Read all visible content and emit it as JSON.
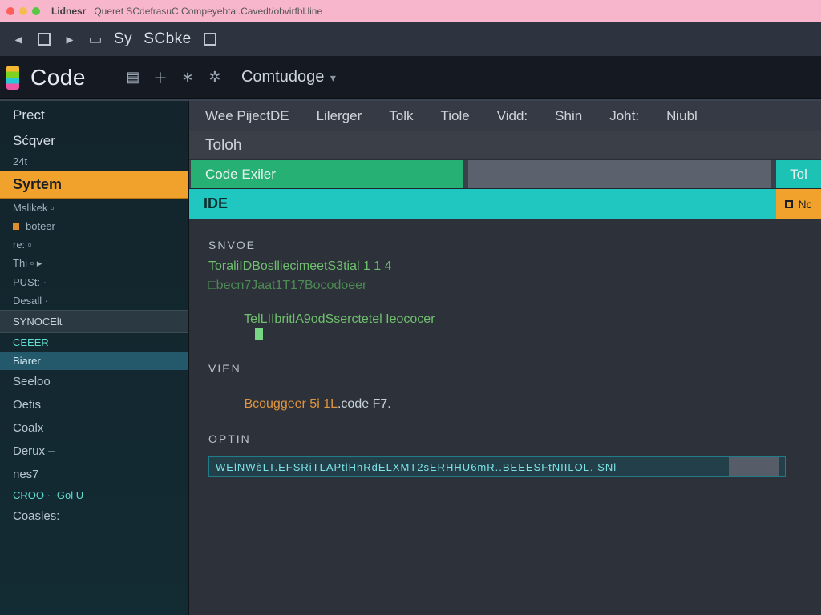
{
  "colors": {
    "accent_orange": "#f0a22c",
    "accent_green": "#26b074",
    "accent_cyan": "#20c7c1"
  },
  "titlebar": {
    "word1": "Lidnesr",
    "word2": "Queret SCdefrasuC Compeyebtal.Cavedt/obvirfbl.line"
  },
  "toolbar": {
    "icons": [
      "arrow-left",
      "square",
      "arrow-right",
      "box"
    ],
    "label1": "Sy",
    "label2": "SCbke",
    "trail_icon": "square"
  },
  "brandrow": {
    "brand": "Code",
    "toolbar_icons": [
      "panel-icon",
      "plus-icon",
      "dot-icon",
      "gear-icon"
    ],
    "breadcrumb": "Comtudoge",
    "chevron": "▾"
  },
  "menus": [
    "Wee PijectDE",
    "Lilerger",
    "Tolk",
    "Tiole",
    "Vidd:",
    "Shin",
    "Joht:",
    "Niubl"
  ],
  "tabs": {
    "path": "Toloh",
    "green": "Code Exiler",
    "grey": "",
    "edge": "Tol",
    "ide_label": "IDE",
    "ide_edge": "Nc"
  },
  "editor": {
    "section1": "SNVOE",
    "line1": "ToraliIDBoslliecimeetS3tial 1 1 4",
    "line2": "□becn7Jaat1T17Bocodoeer_",
    "line3_a": "TelLIIbritlA9odSserctetel Ieococer",
    "section2": "VIEN",
    "line4_a": "Bcouggeer 5i 1L",
    "line4_b": ".code F7.",
    "section3": "OPTIN",
    "input_value": "WElNWèLT.EFSRiTLAPtlHhRdELXMT2sERHHU6mR..BEEESFtNIILOL. SNl"
  },
  "sidebar": {
    "items": [
      {
        "label": "Prect",
        "kind": "big"
      },
      {
        "label": "Sćqver",
        "kind": "big"
      },
      {
        "label": "24t",
        "kind": "sub"
      },
      {
        "label": "Syrtem",
        "kind": "hl"
      },
      {
        "label": "Mslikek ▫",
        "kind": "sub"
      },
      {
        "label": "boteer",
        "kind": "sub",
        "bullet": true
      },
      {
        "label": "re: ▫",
        "kind": "sub"
      },
      {
        "label": "Thi ▫ ▸",
        "kind": "sub"
      },
      {
        "label": "PUSt: ·",
        "kind": "sub"
      },
      {
        "label": "Desall ·",
        "kind": "sub"
      },
      {
        "label": "SYNOCElt",
        "kind": "grey"
      },
      {
        "label": "CEEER",
        "kind": "sub teal"
      },
      {
        "label": "Biarer",
        "kind": "sel"
      },
      {
        "label": "Seeloo",
        "kind": "item"
      },
      {
        "label": "Oetis",
        "kind": "item"
      },
      {
        "label": "Coalx",
        "kind": "item"
      },
      {
        "label": "Derux  –",
        "kind": "item"
      },
      {
        "label": "nes7",
        "kind": "item"
      },
      {
        "label": "CROO   · ·Gol U",
        "kind": "sub teal"
      },
      {
        "label": "Coasles:",
        "kind": "item"
      }
    ]
  }
}
